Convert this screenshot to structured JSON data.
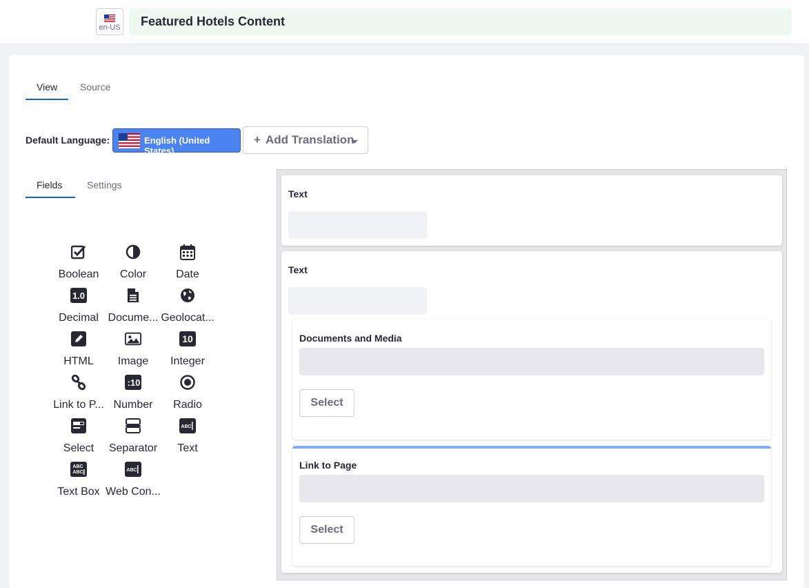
{
  "header": {
    "locale_code": "en-US",
    "title": "Featured Hotels Content"
  },
  "tabs": [
    {
      "label": "View",
      "active": true
    },
    {
      "label": "Source",
      "active": false
    }
  ],
  "language": {
    "default_label": "Default Language:",
    "current": "English (United States)",
    "add_translation": "Add Translation"
  },
  "sidebar_tabs": [
    {
      "label": "Fields",
      "active": true
    },
    {
      "label": "Settings",
      "active": false
    }
  ],
  "fields_palette": [
    {
      "label": "Boolean",
      "icon": "checkbox-icon"
    },
    {
      "label": "Color",
      "icon": "color-icon"
    },
    {
      "label": "Date",
      "icon": "calendar-icon"
    },
    {
      "label": "Decimal",
      "icon": "decimal-icon"
    },
    {
      "label": "Docume...",
      "icon": "document-icon"
    },
    {
      "label": "Geolocat...",
      "icon": "globe-icon"
    },
    {
      "label": "HTML",
      "icon": "pencil-icon"
    },
    {
      "label": "Image",
      "icon": "image-icon"
    },
    {
      "label": "Integer",
      "icon": "integer-icon"
    },
    {
      "label": "Link to P...",
      "icon": "link-icon"
    },
    {
      "label": "Number",
      "icon": "number-icon"
    },
    {
      "label": "Radio",
      "icon": "radio-icon"
    },
    {
      "label": "Select",
      "icon": "select-icon"
    },
    {
      "label": "Separator",
      "icon": "separator-icon"
    },
    {
      "label": "Text",
      "icon": "text-icon"
    },
    {
      "label": "Text Box",
      "icon": "textbox-icon"
    },
    {
      "label": "Web Con...",
      "icon": "webcontent-icon"
    }
  ],
  "form": {
    "field1_label": "Text",
    "field2_label": "Text",
    "nested1_label": "Documents and Media",
    "nested1_button": "Select",
    "nested2_label": "Link to Page",
    "nested2_button": "Select"
  },
  "colors": {
    "accent": "#0b5fff",
    "language_pill": "#4b84f0",
    "title_bg": "#edf9f0",
    "selected_field_bar": "#80acff"
  }
}
